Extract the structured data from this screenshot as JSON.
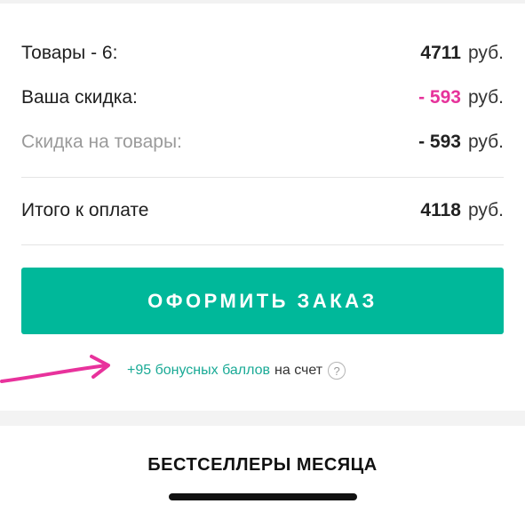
{
  "summary": {
    "items_label": "Товары - 6:",
    "items_amount": "4711",
    "discount_label": "Ваша скидка:",
    "discount_amount": "- 593",
    "goods_discount_label": "Скидка на товары:",
    "goods_discount_amount": "- 593",
    "total_label": "Итого к оплате",
    "total_amount": "4118",
    "currency": "руб."
  },
  "checkout": {
    "button_label": "ОФОРМИТЬ ЗАКАЗ"
  },
  "bonus": {
    "points_text": "+95 бонусных баллов",
    "suffix_text": "на счет",
    "help_symbol": "?"
  },
  "bestsellers": {
    "title": "БЕСТСЕЛЛЕРЫ МЕСЯЦА"
  },
  "colors": {
    "accent": "#00b89a",
    "discount": "#e6339b",
    "bonus_link": "#1aaa96",
    "annotation_arrow": "#e8329c"
  },
  "icons": {
    "annotation": "arrow-right-icon",
    "help": "question-circle-icon"
  }
}
